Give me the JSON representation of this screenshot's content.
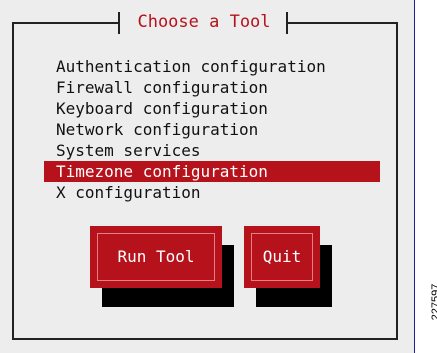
{
  "dialog": {
    "title": "Choose a Tool",
    "items": [
      {
        "label": "Authentication configuration",
        "selected": false
      },
      {
        "label": "Firewall configuration",
        "selected": false
      },
      {
        "label": "Keyboard configuration",
        "selected": false
      },
      {
        "label": "Network configuration",
        "selected": false
      },
      {
        "label": "System services",
        "selected": false
      },
      {
        "label": "Timezone configuration",
        "selected": true
      },
      {
        "label": "X configuration",
        "selected": false
      }
    ],
    "buttons": {
      "run_tool": "Run Tool",
      "quit": "Quit"
    }
  },
  "figure_number": "227597",
  "colors": {
    "accent": "#b5121b",
    "dialog_background": "#ededed",
    "screen_background": "#1e1e9a"
  }
}
